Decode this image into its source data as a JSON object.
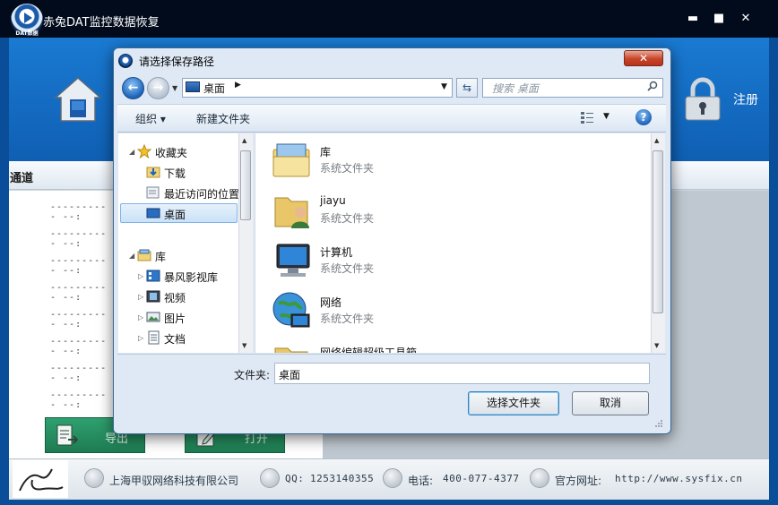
{
  "app": {
    "title": "赤兔DAT监控数据恢复",
    "logo_tag": "DAT数据",
    "column_header": "通道",
    "row_placeholder": "---------- --:",
    "export_label": "导出",
    "open_label": "打开",
    "register_label": "注册",
    "window_controls": {
      "minimize": "▬",
      "maximize": "■",
      "close": "✕"
    }
  },
  "footer": {
    "company": "上海甲驭网络科技有限公司",
    "qq_label": "QQ:",
    "qq_value": "1253140355",
    "phone_label": "电话:",
    "phone_value": "400-077-4377",
    "site_label": "官方网址:",
    "site_value": "http://www.sysfix.cn"
  },
  "dialog": {
    "title": "请选择保存路径",
    "close": "✕",
    "address": "桌面",
    "search_placeholder": "搜索 桌面",
    "toolbar": {
      "organize": "组织 ▾",
      "new_folder": "新建文件夹"
    },
    "nav": {
      "favorites": "收藏夹",
      "downloads": "下载",
      "recent": "最近访问的位置",
      "desktop": "桌面",
      "libraries": "库",
      "storm_video": "暴风影视库",
      "videos": "视频",
      "pictures": "图片",
      "documents": "文档"
    },
    "files": [
      {
        "name": "库",
        "type": "系统文件夹"
      },
      {
        "name": "jiayu",
        "type": "系统文件夹"
      },
      {
        "name": "计算机",
        "type": "系统文件夹"
      },
      {
        "name": "网络",
        "type": "系统文件夹"
      },
      {
        "name": "网络编辑超级工具箱",
        "type": ""
      }
    ],
    "folder_label": "文件夹:",
    "folder_value": "桌面",
    "select_button": "选择文件夹",
    "cancel_button": "取消"
  },
  "colors": {
    "titlebar": "#010b1c",
    "banner": "#1a7ad2",
    "app_button": "#2fa070",
    "dialog_bg": "#dfe9f5",
    "close_red": "#c7452a",
    "selection": "#cbe2f8"
  }
}
